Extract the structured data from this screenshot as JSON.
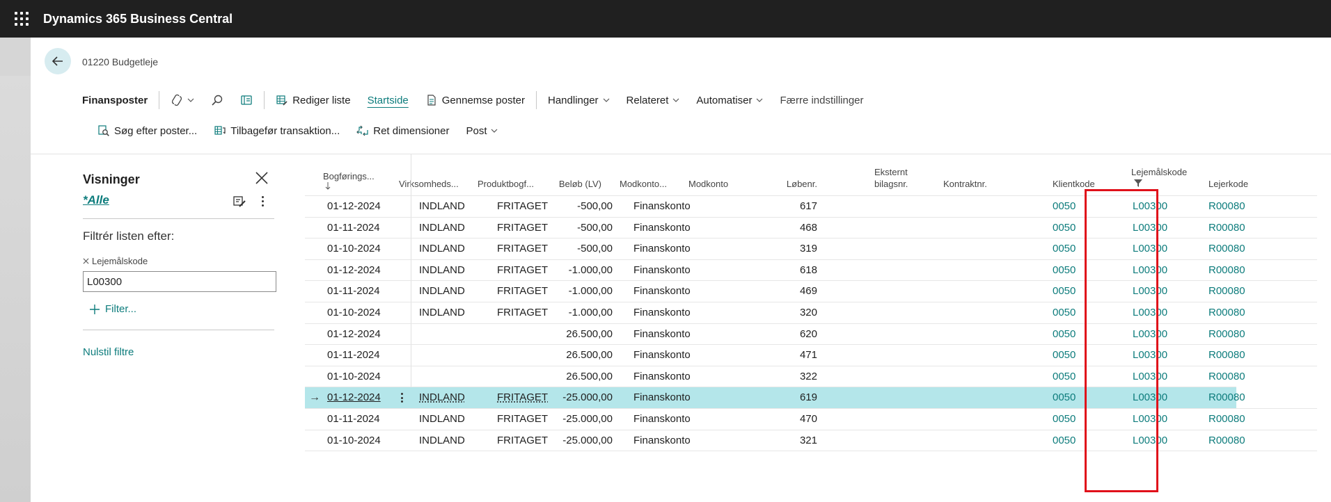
{
  "app": {
    "title": "Dynamics 365 Business Central"
  },
  "page": {
    "breadcrumb": "01220 Budgetleje"
  },
  "actionbar": {
    "row1": {
      "title": "Finansposter",
      "edit_list": "Rediger liste",
      "home": "Startside",
      "browse_entries": "Gennemse poster",
      "actions": "Handlinger",
      "related": "Relateret",
      "automate": "Automatiser",
      "fewer_options": "Færre indstillinger"
    },
    "row2": {
      "find_entries": "Søg efter poster...",
      "reverse_transaction": "Tilbagefør transaktion...",
      "correct_dimensions": "Ret dimensioner",
      "post": "Post"
    }
  },
  "filter_pane": {
    "title": "Visninger",
    "view": "*Alle",
    "filter_label": "Filtrér listen efter:",
    "field_name": "Lejemålskode",
    "field_value": "L00300",
    "add_filter": "Filter...",
    "reset": "Nulstil filtre"
  },
  "grid": {
    "columns": {
      "posting_date": "Bogførings...",
      "gen_bus": "Virksomheds...",
      "gen_prod": "Produktbogf...",
      "amount": "Beløb (LV)",
      "bal_type": "Modkonto...",
      "bal_account": "Modkonto",
      "entry_no": "Løbenr.",
      "external_doc_1": "Eksternt",
      "external_doc_2": "bilagsnr.",
      "contract": "Kontraktnr.",
      "client": "Klientkode",
      "lease": "Lejemålskode",
      "tenant": "Lejerkode"
    },
    "rows": [
      {
        "date": "01-12-2024",
        "bus": "INDLAND",
        "prod": "FRITAGET",
        "amount": "-500,00",
        "bal_type": "Finanskonto",
        "entry": "617",
        "client": "0050",
        "lease": "L00300",
        "tenant": "R00080"
      },
      {
        "date": "01-11-2024",
        "bus": "INDLAND",
        "prod": "FRITAGET",
        "amount": "-500,00",
        "bal_type": "Finanskonto",
        "entry": "468",
        "client": "0050",
        "lease": "L00300",
        "tenant": "R00080"
      },
      {
        "date": "01-10-2024",
        "bus": "INDLAND",
        "prod": "FRITAGET",
        "amount": "-500,00",
        "bal_type": "Finanskonto",
        "entry": "319",
        "client": "0050",
        "lease": "L00300",
        "tenant": "R00080"
      },
      {
        "date": "01-12-2024",
        "bus": "INDLAND",
        "prod": "FRITAGET",
        "amount": "-1.000,00",
        "bal_type": "Finanskonto",
        "entry": "618",
        "client": "0050",
        "lease": "L00300",
        "tenant": "R00080"
      },
      {
        "date": "01-11-2024",
        "bus": "INDLAND",
        "prod": "FRITAGET",
        "amount": "-1.000,00",
        "bal_type": "Finanskonto",
        "entry": "469",
        "client": "0050",
        "lease": "L00300",
        "tenant": "R00080"
      },
      {
        "date": "01-10-2024",
        "bus": "INDLAND",
        "prod": "FRITAGET",
        "amount": "-1.000,00",
        "bal_type": "Finanskonto",
        "entry": "320",
        "client": "0050",
        "lease": "L00300",
        "tenant": "R00080"
      },
      {
        "date": "01-12-2024",
        "bus": "",
        "prod": "",
        "amount": "26.500,00",
        "bal_type": "Finanskonto",
        "entry": "620",
        "client": "0050",
        "lease": "L00300",
        "tenant": "R00080"
      },
      {
        "date": "01-11-2024",
        "bus": "",
        "prod": "",
        "amount": "26.500,00",
        "bal_type": "Finanskonto",
        "entry": "471",
        "client": "0050",
        "lease": "L00300",
        "tenant": "R00080"
      },
      {
        "date": "01-10-2024",
        "bus": "",
        "prod": "",
        "amount": "26.500,00",
        "bal_type": "Finanskonto",
        "entry": "322",
        "client": "0050",
        "lease": "L00300",
        "tenant": "R00080"
      },
      {
        "date": "01-12-2024",
        "bus": "INDLAND",
        "prod": "FRITAGET",
        "amount": "-25.000,00",
        "bal_type": "Finanskonto",
        "entry": "619",
        "client": "0050",
        "lease": "L00300",
        "tenant": "R00080",
        "selected": true
      },
      {
        "date": "01-11-2024",
        "bus": "INDLAND",
        "prod": "FRITAGET",
        "amount": "-25.000,00",
        "bal_type": "Finanskonto",
        "entry": "470",
        "client": "0050",
        "lease": "L00300",
        "tenant": "R00080"
      },
      {
        "date": "01-10-2024",
        "bus": "INDLAND",
        "prod": "FRITAGET",
        "amount": "-25.000,00",
        "bal_type": "Finanskonto",
        "entry": "321",
        "client": "0050",
        "lease": "L00300",
        "tenant": "R00080"
      }
    ]
  },
  "colors": {
    "accent": "#0d7c7c",
    "selected_row": "#b4e6ea",
    "highlight": "#e0101a",
    "appbar": "#202020"
  },
  "icons": [
    "waffle-icon",
    "back-arrow-icon",
    "copilot-icon",
    "search-icon",
    "filter-pane-icon",
    "edit-list-icon",
    "browse-icon",
    "find-entries-icon",
    "reverse-icon",
    "dimensions-icon",
    "close-icon",
    "edit-view-icon",
    "more-icon",
    "plus-icon",
    "remove-filter-icon",
    "sort-down-icon",
    "column-filter-icon",
    "row-arrow-icon"
  ]
}
